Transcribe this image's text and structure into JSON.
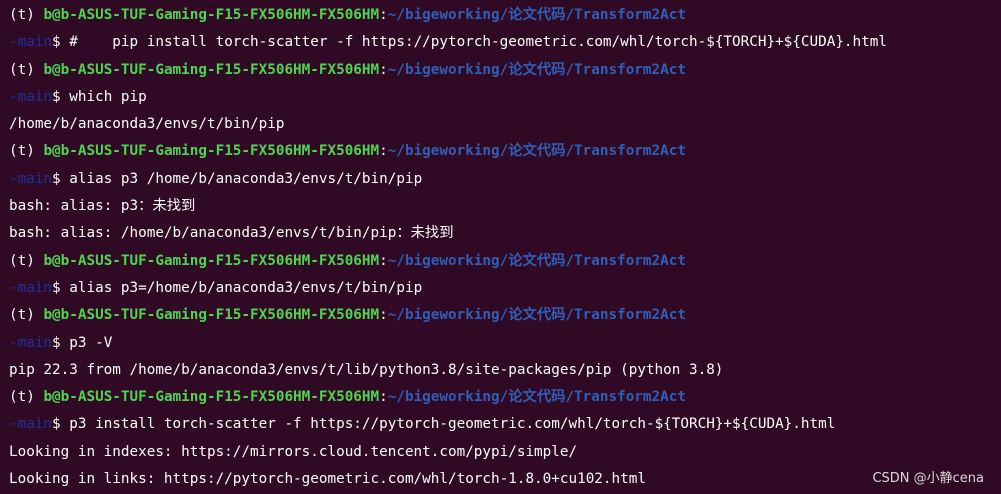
{
  "theme": {
    "background": "#300a24",
    "user_color": "#4fd44f",
    "path_color": "#2f5fb8",
    "branch_color": "#1f2f9e",
    "text_color": "#ffffff"
  },
  "lines": [
    {
      "kind": "prompt",
      "env": "(t) ",
      "user": "b@b-ASUS-TUF-Gaming-F15-FX506HM-FX506HM",
      "sep": ":",
      "path": "~/bigeworking/论文代码/Transform2Act"
    },
    {
      "kind": "command",
      "branch": "-main",
      "dollar": "$ ",
      "cmd": "#    pip install torch-scatter -f https://pytorch-geometric.com/whl/torch-${TORCH}+${CUDA}.html"
    },
    {
      "kind": "prompt",
      "env": "(t) ",
      "user": "b@b-ASUS-TUF-Gaming-F15-FX506HM-FX506HM",
      "sep": ":",
      "path": "~/bigeworking/论文代码/Transform2Act"
    },
    {
      "kind": "command",
      "branch": "-main",
      "dollar": "$ ",
      "cmd": "which pip"
    },
    {
      "kind": "output",
      "text": "/home/b/anaconda3/envs/t/bin/pip"
    },
    {
      "kind": "prompt",
      "env": "(t) ",
      "user": "b@b-ASUS-TUF-Gaming-F15-FX506HM-FX506HM",
      "sep": ":",
      "path": "~/bigeworking/论文代码/Transform2Act"
    },
    {
      "kind": "command",
      "branch": "-main",
      "dollar": "$ ",
      "cmd": "alias p3 /home/b/anaconda3/envs/t/bin/pip"
    },
    {
      "kind": "output",
      "text": "bash: alias: p3：未找到"
    },
    {
      "kind": "output",
      "text": "bash: alias: /home/b/anaconda3/envs/t/bin/pip：未找到"
    },
    {
      "kind": "prompt",
      "env": "(t) ",
      "user": "b@b-ASUS-TUF-Gaming-F15-FX506HM-FX506HM",
      "sep": ":",
      "path": "~/bigeworking/论文代码/Transform2Act"
    },
    {
      "kind": "command",
      "branch": "-main",
      "dollar": "$ ",
      "cmd": "alias p3=/home/b/anaconda3/envs/t/bin/pip"
    },
    {
      "kind": "prompt",
      "env": "(t) ",
      "user": "b@b-ASUS-TUF-Gaming-F15-FX506HM-FX506HM",
      "sep": ":",
      "path": "~/bigeworking/论文代码/Transform2Act"
    },
    {
      "kind": "command",
      "branch": "-main",
      "dollar": "$ ",
      "cmd": "p3 -V"
    },
    {
      "kind": "output",
      "text": "pip 22.3 from /home/b/anaconda3/envs/t/lib/python3.8/site-packages/pip (python 3.8)"
    },
    {
      "kind": "prompt",
      "env": "(t) ",
      "user": "b@b-ASUS-TUF-Gaming-F15-FX506HM-FX506HM",
      "sep": ":",
      "path": "~/bigeworking/论文代码/Transform2Act"
    },
    {
      "kind": "command",
      "branch": "-main",
      "dollar": "$ ",
      "cmd": "p3 install torch-scatter -f https://pytorch-geometric.com/whl/torch-${TORCH}+${CUDA}.html"
    },
    {
      "kind": "output",
      "text": "Looking in indexes: https://mirrors.cloud.tencent.com/pypi/simple/"
    },
    {
      "kind": "output",
      "text": "Looking in links: https://pytorch-geometric.com/whl/torch-1.8.0+cu102.html"
    }
  ],
  "watermark": "CSDN @小静cena"
}
